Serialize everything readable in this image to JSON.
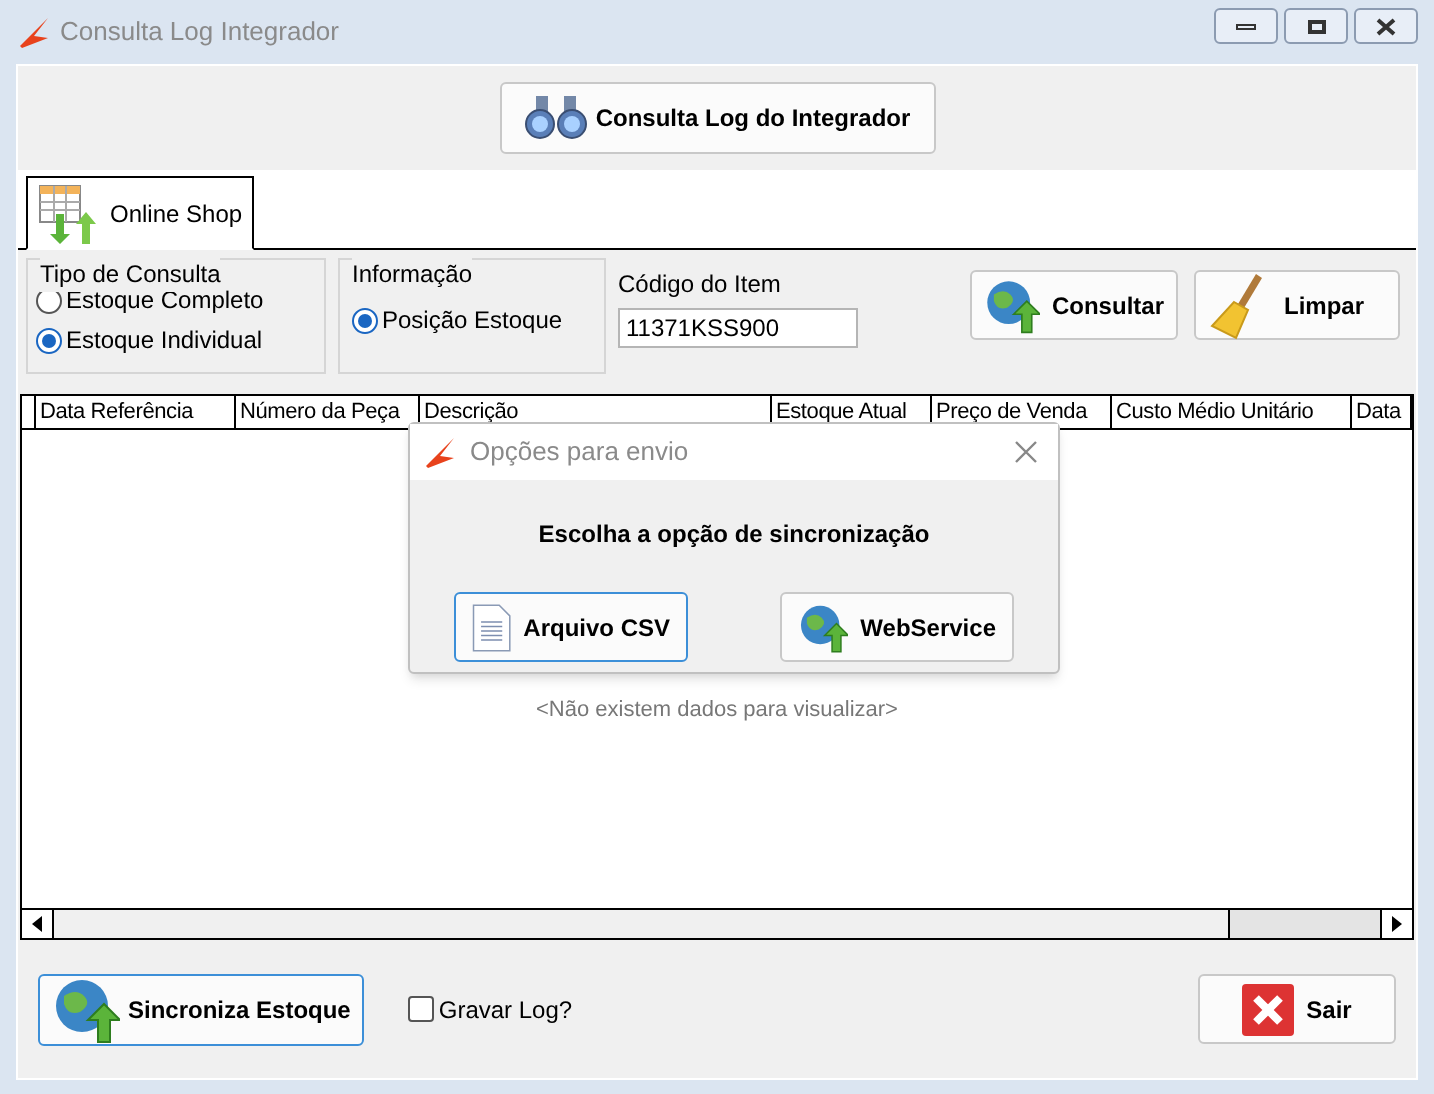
{
  "window": {
    "title": "Consulta Log Integrador"
  },
  "top_button": {
    "label": "Consulta Log do Integrador"
  },
  "tabs": [
    {
      "label": "Online Shop",
      "selected": true
    }
  ],
  "tipo_de_consulta": {
    "title": "Tipo de Consulta",
    "options": [
      {
        "label": "Estoque Completo",
        "selected": false
      },
      {
        "label": "Estoque Individual",
        "selected": true
      }
    ]
  },
  "informacao": {
    "title": "Informação",
    "options": [
      {
        "label": "Posição Estoque",
        "selected": true
      }
    ]
  },
  "codigo_do_item": {
    "label": "Código do Item",
    "value": "11371KSS900"
  },
  "action_buttons": [
    {
      "label": "Consultar",
      "kind": "globe"
    },
    {
      "label": "Limpar",
      "kind": "broom"
    }
  ],
  "table": {
    "columns": [
      "Data Referência",
      "Número da Peça",
      "Descrição",
      "Estoque Atual",
      "Preço de Venda",
      "Custo Médio Unitário",
      "Data"
    ],
    "empty_message": "<Não existem dados para visualizar>"
  },
  "dialog": {
    "title": "Opções para envio",
    "message": "Escolha a opção de sincronização",
    "buttons": [
      {
        "label": "Arquivo CSV",
        "kind": "document",
        "focused": true
      },
      {
        "label": "WebService",
        "kind": "globe",
        "focused": false
      }
    ]
  },
  "bottom": {
    "sync_button": "Sincroniza Estoque",
    "log_checkbox": {
      "label": "Gravar Log?",
      "checked": false
    },
    "exit_button": "Sair"
  }
}
